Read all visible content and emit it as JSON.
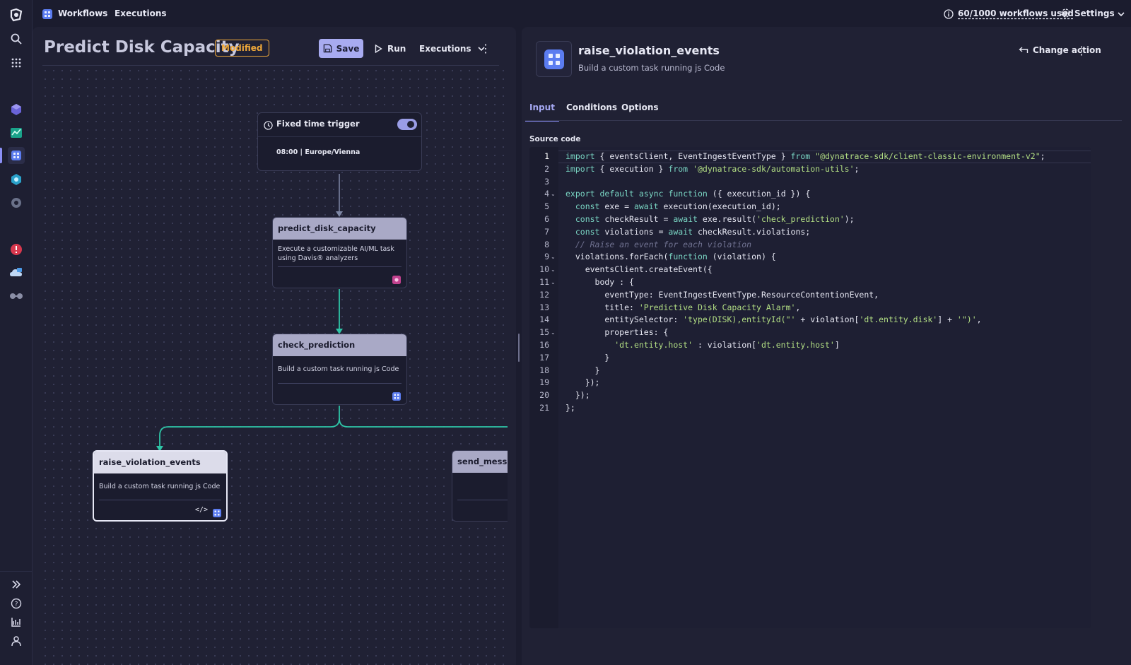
{
  "topbar": {
    "tab_workflows": "Workflows",
    "tab_executions": "Executions",
    "quota": "60/1000 workflows used",
    "settings": "Settings"
  },
  "workflow": {
    "title": "Predict Disk Capacity",
    "badge": "Modified",
    "save_label": "Save",
    "run_label": "Run",
    "executions_label": "Executions"
  },
  "nodes": {
    "trigger_title": "Fixed time trigger",
    "trigger_enabled": true,
    "trigger_schedule": "08:00 | Europe/Vienna",
    "predict": {
      "title": "predict_disk_capacity",
      "desc": "Execute a customizable AI/ML task using Davis® analyzers"
    },
    "check": {
      "title": "check_prediction",
      "desc": "Build a custom task running js Code"
    },
    "raise": {
      "title": "raise_violation_events",
      "desc": "Build a custom task running js Code"
    },
    "send": {
      "title": "send_mess"
    }
  },
  "action": {
    "title": "raise_violation_events",
    "subtitle": "Build a custom task running js Code",
    "change_label": "Change action",
    "tabs": [
      "Input",
      "Conditions",
      "Options"
    ],
    "active_tab": "Input",
    "source_label": "Source code"
  },
  "code": {
    "lines": [
      "import { eventsClient, EventIngestEventType } from \"@dynatrace-sdk/client-classic-environment-v2\";",
      "import { execution } from '@dynatrace-sdk/automation-utils';",
      "",
      "export default async function ({ execution_id }) {",
      "  const exe = await execution(execution_id);",
      "  const checkResult = await exe.result('check_prediction');",
      "  const violations = await checkResult.violations;",
      "  // Raise an event for each violation",
      "  violations.forEach(function (violation) {",
      "    eventsClient.createEvent({",
      "      body : {",
      "        eventType: EventIngestEventType.ResourceContentionEvent,",
      "        title: 'Predictive Disk Capacity Alarm',",
      "        entitySelector: 'type(DISK),entityId(\"' + violation['dt.entity.disk'] + '\")',",
      "        properties: {",
      "          'dt.entity.host' : violation['dt.entity.host']",
      "        }",
      "      }",
      "    });",
      "  });",
      "};"
    ],
    "folded_lines": [
      4,
      9,
      10,
      11,
      15
    ]
  },
  "colors": {
    "accent": "#8b8ff5",
    "modified": "#f0a93a",
    "edge": "#2ec4a6"
  }
}
